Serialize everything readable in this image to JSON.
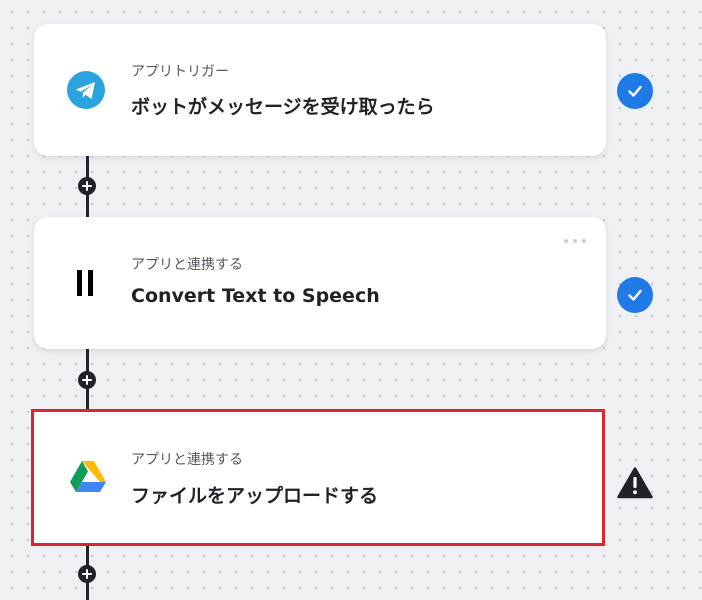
{
  "flow": {
    "steps": [
      {
        "subtitle": "アプリトリガー",
        "title": "ボットがメッセージを受け取ったら",
        "app_icon": "telegram-icon",
        "status": "completed"
      },
      {
        "subtitle": "アプリと連携する",
        "title": "Convert Text to Speech",
        "app_icon": "elevenlabs-icon",
        "status": "completed"
      },
      {
        "subtitle": "アプリと連携する",
        "title": "ファイルをアップロードする",
        "app_icon": "google-drive-icon",
        "status": "warning"
      }
    ]
  },
  "colors": {
    "accent_blue": "#1f7ae8",
    "selected_border": "#e0242b",
    "telegram": "#2aa3df",
    "warning": "#1f2328",
    "connector": "#1f2328"
  }
}
